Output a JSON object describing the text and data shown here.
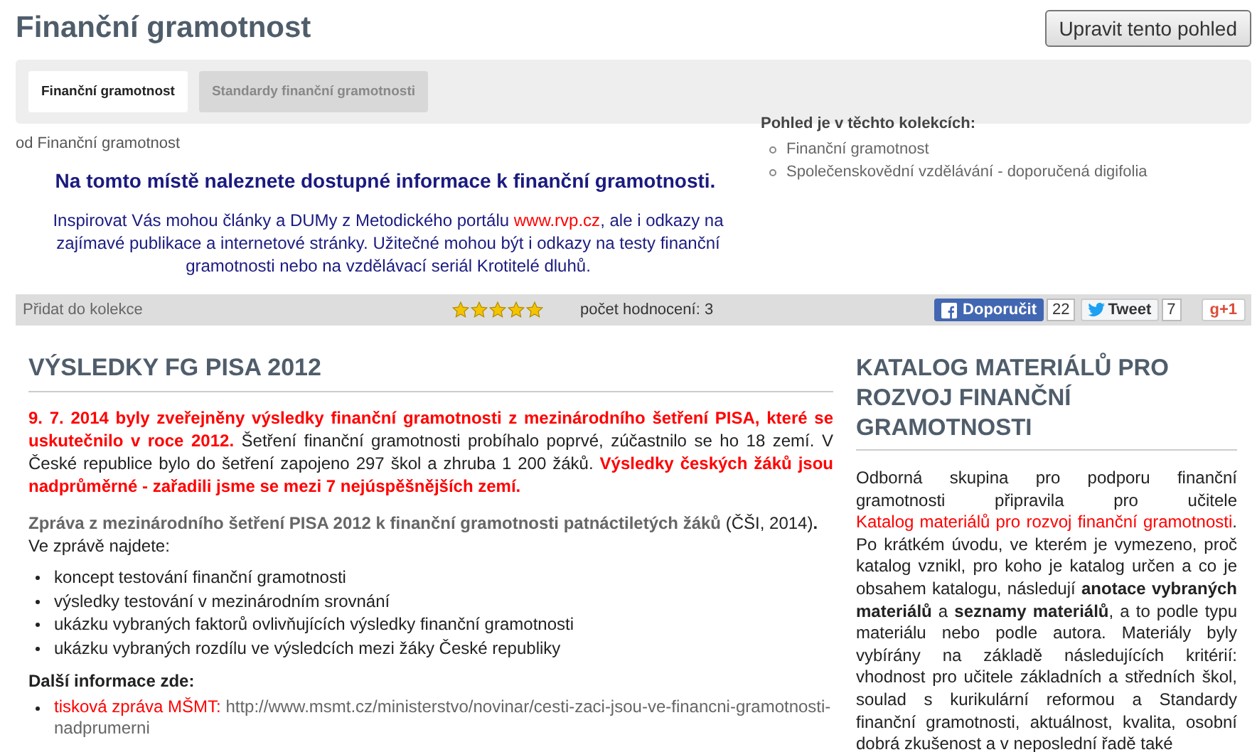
{
  "page": {
    "title": "Finanční gramotnost",
    "edit_button": "Upravit tento pohled"
  },
  "tabs": [
    {
      "label": "Finanční gramotnost",
      "selected": true
    },
    {
      "label": "Standardy finanční gramotnosti",
      "selected": false
    }
  ],
  "intro": {
    "author": "od Finanční gramotnost",
    "heading": "Na tomto místě naleznete dostupné informace k finanční gramotnosti.",
    "text": [
      {
        "kind": "plain",
        "text": "Inspirovat Vás mohou články a DUMy z Metodického portálu "
      },
      {
        "kind": "link",
        "text": "www.rvp.cz"
      },
      {
        "kind": "plain",
        "text": ", ale i odkazy na zajímavé publikace a internetové stránky. Užitečné mohou být i odkazy na testy finanční gramotnosti nebo na vzdělávací seriál Krotitelé dluhů."
      }
    ]
  },
  "collections": {
    "title": "Pohled je v těchto kolekcích:",
    "items": [
      "Finanční gramotnost",
      "Společenskovědní vzdělávání - doporučená digifolia"
    ]
  },
  "rating_bar": {
    "add_link": "Přidat do kolekce",
    "stars": 5,
    "count_label": "počet hodnocení: 3",
    "social": [
      {
        "kind": "facebook",
        "label": "Doporučit",
        "count": "22"
      },
      {
        "kind": "twitter",
        "label": "Tweet",
        "count": "7"
      },
      {
        "kind": "google",
        "label": "g+1"
      }
    ]
  },
  "main": {
    "heading": "VÝSLEDKY FG PISA 2012",
    "paragraphs": [
      [
        {
          "kind": "alert",
          "text": "9. 7. 2014 byly zveřejněny výsledky finanční gramotnosti z mezinárodního šetření PISA, které se uskutečnilo v roce 2012."
        },
        {
          "kind": "plain",
          "text": " Šetření finanční gramotnosti probíhalo poprvé, zúčastnilo se ho 18 zemí. V České republice bylo do šetření zapojeno 297 škol a zhruba 1 200 žáků. "
        },
        {
          "kind": "alert",
          "text": "Výsledky českých žáků jsou nadprůměrné - zařadili jsme se mezi 7 nejúspěšnějších zemí."
        }
      ],
      [
        {
          "kind": "doclink",
          "text": "Zpráva z mezinárodního šetření PISA 2012 k finanční gramotnosti patnáctiletých žáků"
        },
        {
          "kind": "plain",
          "text": " (ČŠI, 2014)"
        },
        {
          "kind": "bold",
          "text": "."
        },
        {
          "kind": "break"
        },
        {
          "kind": "plain",
          "text": "Ve zprávě najdete:"
        }
      ]
    ],
    "bullets": [
      "koncept testování finanční gramotnosti",
      "výsledky testování v mezinárodním srovnání",
      "ukázku vybraných faktorů ovlivňujících výsledky finanční gramotnosti",
      "ukázku vybraných rozdílu ve výsledcích mezi žáky České republiky"
    ],
    "more_title": "Další informace zde:",
    "links": [
      {
        "label": "tisková zpráva MŠMT:",
        "url": "http://www.msmt.cz/ministerstvo/novinar/cesti-zaci-jsou-ve-financni-gramotnosti-nadprumerni"
      }
    ]
  },
  "side": {
    "heading": "KATALOG MATERIÁLŮ PRO ROZVOJ FINANČNÍ GRAMOTNOSTI",
    "paragraph": [
      {
        "kind": "plain",
        "text": "Odborná skupina pro podporu finanční gramotnosti připravila pro učitele "
      },
      {
        "kind": "link",
        "text": "Katalog materiálů pro rozvoj finanční gramotnosti"
      },
      {
        "kind": "plain",
        "text": ". Po krátkém úvodu, ve kterém je vymezeno, proč katalog vznikl, pro koho je katalog určen a co je obsahem katalogu, následují "
      },
      {
        "kind": "bold",
        "text": "anotace vybraných materiálů"
      },
      {
        "kind": "plain",
        "text": " a "
      },
      {
        "kind": "bold",
        "text": "seznamy materiálů"
      },
      {
        "kind": "plain",
        "text": ", a to podle typu materiálu nebo podle autora. Materiály byly vybírány na základě následujících kritérií: vhodnost pro učitele základních a středních škol, soulad s kurikulární reformou a Standardy finanční gramotnosti, aktuálnost, kvalita, osobní dobrá zkušenost a v neposlední řadě také"
      }
    ]
  }
}
